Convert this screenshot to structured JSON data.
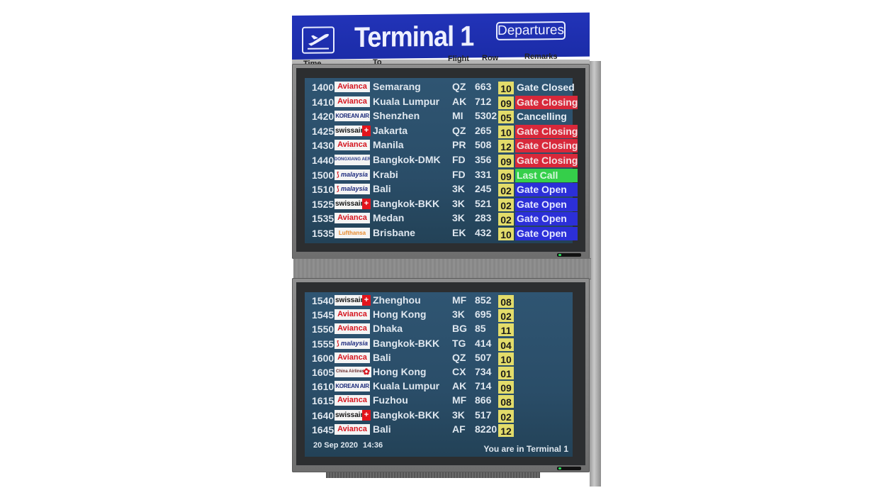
{
  "header": {
    "title": "Terminal 1",
    "badge": "Departures",
    "logo_icon": "departing-plane-icon",
    "columns": {
      "time": "Time",
      "to": "To",
      "flight": "Flight",
      "row": "Row",
      "remarks": "Remarks"
    }
  },
  "top_board": {
    "rows": [
      {
        "time": "1400",
        "airline": "Avianca",
        "logo": "avianca",
        "destination": "Semarang",
        "carrier": "QZ",
        "number": "663",
        "row": "10",
        "remark": "Gate Closed",
        "status": "closed"
      },
      {
        "time": "1410",
        "airline": "Avianca",
        "logo": "avianca",
        "destination": "Kuala Lumpur",
        "carrier": "AK",
        "number": "712",
        "row": "09",
        "remark": "Gate Closing",
        "status": "closing"
      },
      {
        "time": "1420",
        "airline": "KOREAN AIR",
        "logo": "korean",
        "destination": "Shenzhen",
        "carrier": "MI",
        "number": "5302",
        "row": "05",
        "remark": "Cancelling",
        "status": "cancelling"
      },
      {
        "time": "1425",
        "airline": "swissair",
        "logo": "swissair",
        "destination": "Jakarta",
        "carrier": "QZ",
        "number": "265",
        "row": "10",
        "remark": "Gate Closing",
        "status": "closing"
      },
      {
        "time": "1430",
        "airline": "Avianca",
        "logo": "avianca",
        "destination": "Manila",
        "carrier": "PR",
        "number": "508",
        "row": "12",
        "remark": "Gate Closing",
        "status": "closing"
      },
      {
        "time": "1440",
        "airline": "DONGXIANG AERO",
        "logo": "dongxiang",
        "destination": "Bangkok-DMK",
        "carrier": "FD",
        "number": "356",
        "row": "09",
        "remark": "Gate Closing",
        "status": "closing"
      },
      {
        "time": "1500",
        "airline": "malaysia",
        "logo": "malaysia",
        "destination": "Krabi",
        "carrier": "FD",
        "number": "331",
        "row": "09",
        "remark": "Last Call",
        "status": "lastcall"
      },
      {
        "time": "1510",
        "airline": "malaysia",
        "logo": "malaysia",
        "destination": "Bali",
        "carrier": "3K",
        "number": "245",
        "row": "02",
        "remark": "Gate Open",
        "status": "open"
      },
      {
        "time": "1525",
        "airline": "swissair",
        "logo": "swissair",
        "destination": "Bangkok-BKK",
        "carrier": "3K",
        "number": "521",
        "row": "02",
        "remark": "Gate Open",
        "status": "open"
      },
      {
        "time": "1535",
        "airline": "Avianca",
        "logo": "avianca",
        "destination": "Medan",
        "carrier": "3K",
        "number": "283",
        "row": "02",
        "remark": "Gate Open",
        "status": "open"
      },
      {
        "time": "1535",
        "airline": "Lufthansa",
        "logo": "lufthansa",
        "destination": "Brisbane",
        "carrier": "EK",
        "number": "432",
        "row": "10",
        "remark": "Gate Open",
        "status": "open"
      }
    ]
  },
  "bottom_board": {
    "rows": [
      {
        "time": "1540",
        "airline": "swissair",
        "logo": "swissair",
        "destination": "Zhenghou",
        "carrier": "MF",
        "number": "852",
        "row": "08"
      },
      {
        "time": "1545",
        "airline": "Avianca",
        "logo": "avianca",
        "destination": "Hong Kong",
        "carrier": "3K",
        "number": "695",
        "row": "02"
      },
      {
        "time": "1550",
        "airline": "Avianca",
        "logo": "avianca",
        "destination": "Dhaka",
        "carrier": "BG",
        "number": "85",
        "row": "11"
      },
      {
        "time": "1555",
        "airline": "malaysia",
        "logo": "malaysia",
        "destination": "Bangkok-BKK",
        "carrier": "TG",
        "number": "414",
        "row": "04"
      },
      {
        "time": "1600",
        "airline": "Avianca",
        "logo": "avianca",
        "destination": "Bali",
        "carrier": "QZ",
        "number": "507",
        "row": "10"
      },
      {
        "time": "1605",
        "airline": "China Airlines",
        "logo": "china",
        "destination": "Hong Kong",
        "carrier": "CX",
        "number": "734",
        "row": "01"
      },
      {
        "time": "1610",
        "airline": "KOREAN AIR",
        "logo": "korean",
        "destination": "Kuala Lumpur",
        "carrier": "AK",
        "number": "714",
        "row": "09"
      },
      {
        "time": "1615",
        "airline": "Avianca",
        "logo": "avianca",
        "destination": "Fuzhou",
        "carrier": "MF",
        "number": "866",
        "row": "08"
      },
      {
        "time": "1640",
        "airline": "swissair",
        "logo": "swissair",
        "destination": "Bangkok-BKK",
        "carrier": "3K",
        "number": "517",
        "row": "02"
      },
      {
        "time": "1645",
        "airline": "Avianca",
        "logo": "avianca",
        "destination": "Bali",
        "carrier": "AF",
        "number": "8220",
        "row": "12"
      }
    ],
    "footer": {
      "date": "20 Sep 2020",
      "time": "14:36",
      "location": "You are in Terminal 1"
    }
  },
  "colors": {
    "sign_blue": "#1f30b0",
    "screen_bg": "#2c4f6a",
    "row_badge": "#e3dc6a",
    "gate_closing": "#d8283a",
    "last_call": "#35cf4a",
    "gate_open": "#2c2fd8"
  }
}
